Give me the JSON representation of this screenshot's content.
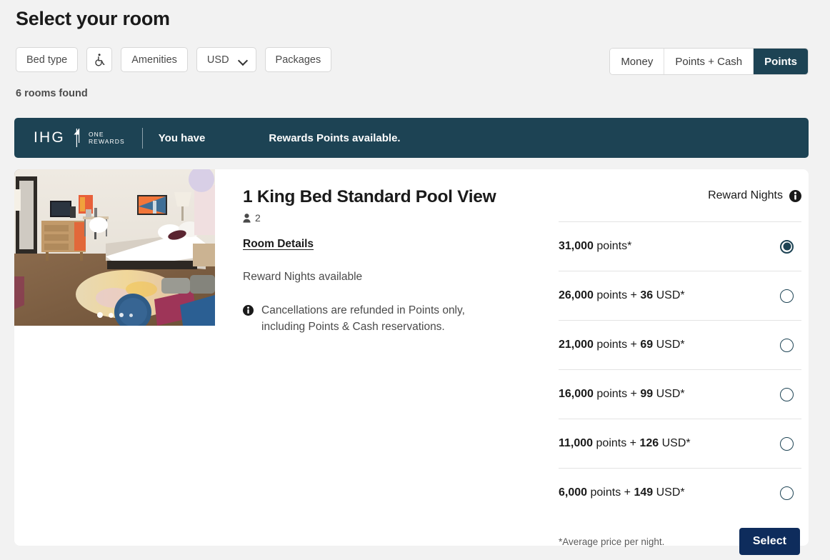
{
  "header": {
    "title": "Select your room",
    "rooms_found": "6 rooms found"
  },
  "filters": {
    "bed_type": "Bed type",
    "accessibility_icon": "wheelchair-icon",
    "amenities": "Amenities",
    "currency": "USD",
    "packages": "Packages"
  },
  "rate_toggle": {
    "options": [
      "Money",
      "Points + Cash",
      "Points"
    ],
    "selected": "Points",
    "active_bg": "#1d4354"
  },
  "banner": {
    "brand_word": "IHG",
    "brand_line1": "ONE",
    "brand_line2": "REWARDS",
    "you_have": "You have",
    "points_available": "Rewards Points available.",
    "bg_color": "#1d4354"
  },
  "room": {
    "name": "1 King Bed Standard Pool View",
    "occupancy": "2",
    "occupancy_icon": "person-icon",
    "details_link": "Room Details",
    "reward_available": "Reward Nights available",
    "cancellation_note": "Cancellations are refunded in Points only, including Points & Cash reservations.",
    "cancellation_icon": "info-icon",
    "carousel_dots": 4,
    "carousel_active_index": 0
  },
  "pricing": {
    "header_label": "Reward Nights",
    "header_icon": "info-icon",
    "rows": [
      {
        "points": "31,000",
        "points_word": "points",
        "plus": "",
        "cash": "",
        "currency": "",
        "asterisk": "*",
        "selected": true
      },
      {
        "points": "26,000",
        "points_word": "points",
        "plus": "+",
        "cash": "36",
        "currency": "USD",
        "asterisk": "*",
        "selected": false
      },
      {
        "points": "21,000",
        "points_word": "points",
        "plus": "+",
        "cash": "69",
        "currency": "USD",
        "asterisk": "*",
        "selected": false
      },
      {
        "points": "16,000",
        "points_word": "points",
        "plus": "+",
        "cash": "99",
        "currency": "USD",
        "asterisk": "*",
        "selected": false
      },
      {
        "points": "11,000",
        "points_word": "points",
        "plus": "+",
        "cash": "126",
        "currency": "USD",
        "asterisk": "*",
        "selected": false
      },
      {
        "points": "6,000",
        "points_word": "points",
        "plus": "+",
        "cash": "149",
        "currency": "USD",
        "asterisk": "*",
        "selected": false
      }
    ],
    "average_note": "*Average price per night.",
    "select_button": "Select",
    "select_button_color": "#0e2c5c"
  },
  "row_labels": {
    "r0": "31,000 points*",
    "r1": "26,000 points + 36 USD*",
    "r2": "21,000 points + 69 USD*",
    "r3": "16,000 points + 99 USD*",
    "r4": "11,000 points + 126 USD*",
    "r5": "6,000 points + 149 USD*"
  }
}
